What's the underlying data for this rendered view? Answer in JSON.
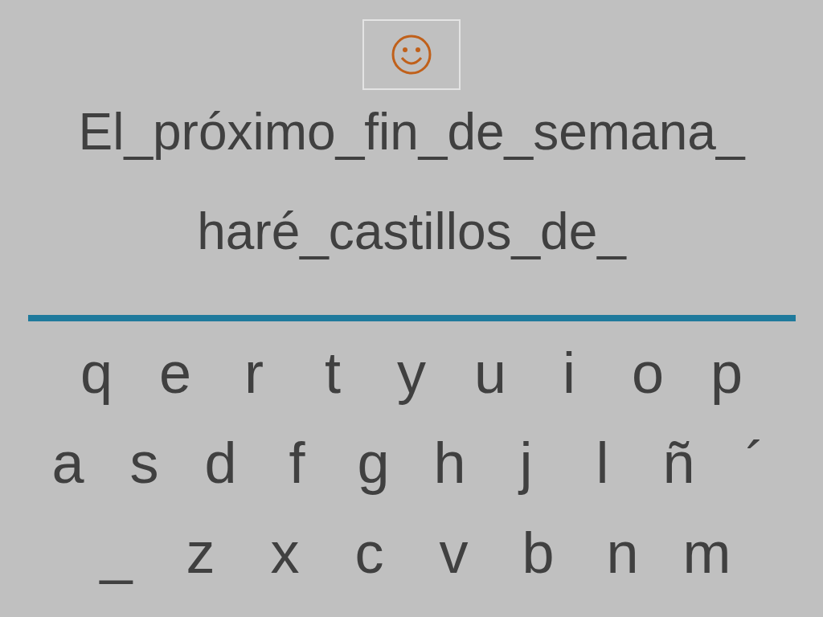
{
  "sentence_lines": [
    "El_próximo_fin_de_semana_",
    "haré_castillos_de_"
  ],
  "keyboard": {
    "rows": [
      {
        "keys": [
          "q",
          "e",
          "r",
          "t",
          "y",
          "u",
          "i",
          "o",
          "p"
        ]
      },
      {
        "keys": [
          "a",
          "s",
          "d",
          "f",
          "g",
          "h",
          "j",
          "l",
          "ñ",
          "´"
        ]
      },
      {
        "keys": [
          "_",
          "z",
          "x",
          "c",
          "v",
          "b",
          "n",
          "m"
        ]
      }
    ]
  }
}
